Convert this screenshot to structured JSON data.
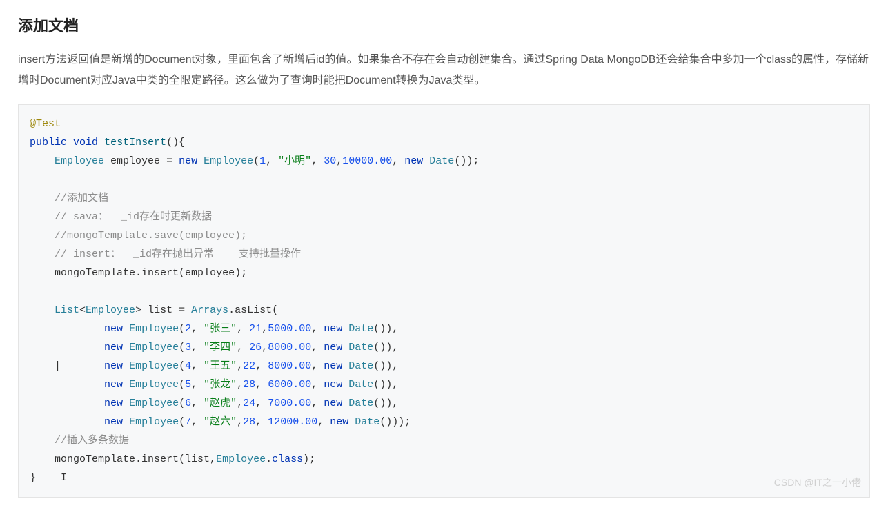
{
  "title": "添加文档",
  "description": "insert方法返回值是新增的Document对象，里面包含了新增后id的值。如果集合不存在会自动创建集合。通过Spring Data MongoDB还会给集合中多加一个class的属性，存储新增时Document对应Java中类的全限定路径。这么做为了查询时能把Document转换为Java类型。",
  "code": {
    "annotation": "@Test",
    "kw_public": "public",
    "kw_void": "void",
    "method_name": "testInsert",
    "type_employee": "Employee",
    "var_employee": "employee",
    "kw_new": "new",
    "emp1_id": "1",
    "emp1_name": "\"小明\"",
    "emp1_age": "30",
    "emp1_salary": "10000.00",
    "type_date": "Date",
    "comment_add": "//添加文档",
    "comment_save": "// sava：  _id",
    "comment_save_tail": "存在时更新数据",
    "comment_save_line": "//mongoTemplate.save(employee);",
    "comment_insert": "// insert",
    "comment_insert_mid": "：  _id",
    "comment_insert_tail": "存在抛出异常    支持批量操作",
    "stmt_insert": "mongoTemplate.insert(employee);",
    "mongo": "mongoTemplate",
    "dot_insert": ".insert(employee);",
    "type_list": "List",
    "var_list": "list",
    "arrays_aslist": "Arrays.asList",
    "type_arrays": "Arrays",
    "aslist": ".asList(",
    "e2": {
      "id": "2",
      "name": "\"张三\"",
      "age": "21",
      "salary": "5000.00"
    },
    "e3": {
      "id": "3",
      "name": "\"李四\"",
      "age": "26",
      "salary": "8000.00"
    },
    "e4": {
      "id": "4",
      "name": "\"王五\"",
      "age": "22",
      "salary": "8000.00"
    },
    "e5": {
      "id": "5",
      "name": "\"张龙\"",
      "age": "28",
      "salary": "6000.00"
    },
    "e6": {
      "id": "6",
      "name": "\"赵虎\"",
      "age": "24",
      "salary": "7000.00"
    },
    "e7": {
      "id": "7",
      "name": "\"赵六\"",
      "age": "28",
      "salary": "12000.00"
    },
    "comment_multi": "//插入多条数据",
    "insert_list_pre": "mongoTemplate.insert(list,",
    "insert_list_cls": "Employee",
    "insert_list_post": ".class);",
    "dot_class": ".",
    "class_kw": "class"
  },
  "watermark": "CSDN @IT之一小佬"
}
